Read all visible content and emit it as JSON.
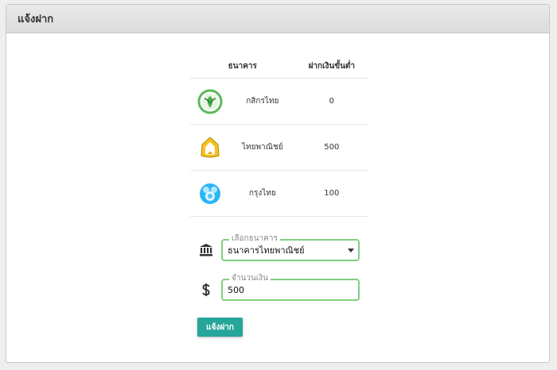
{
  "header": {
    "title": "แจ้งฝาก"
  },
  "bank_table": {
    "columns": [
      "ธนาคาร",
      "ฝากเงินขั้นต่ำ"
    ],
    "rows": [
      {
        "logo_icon": "kasikorn-logo-icon",
        "name": "กสิกรไทย",
        "min_deposit": "0"
      },
      {
        "logo_icon": "scb-logo-icon",
        "name": "ไทยพาณิชย์",
        "min_deposit": "500"
      },
      {
        "logo_icon": "krungthai-logo-icon",
        "name": "กรุงไทย",
        "min_deposit": "100"
      }
    ]
  },
  "form": {
    "bank_select": {
      "label": "เลือกธนาคาร",
      "value": "ธนาคารไทยพาณิชย์",
      "icon": "bank-icon"
    },
    "amount": {
      "label": "จำนวนเงิน",
      "value": "500",
      "icon": "dollar-icon"
    },
    "submit_label": "แจ้งฝาก"
  },
  "colors": {
    "accent": "#26a69a",
    "field_border": "#7fcf7f",
    "header_bg": "#e2e2e2"
  }
}
